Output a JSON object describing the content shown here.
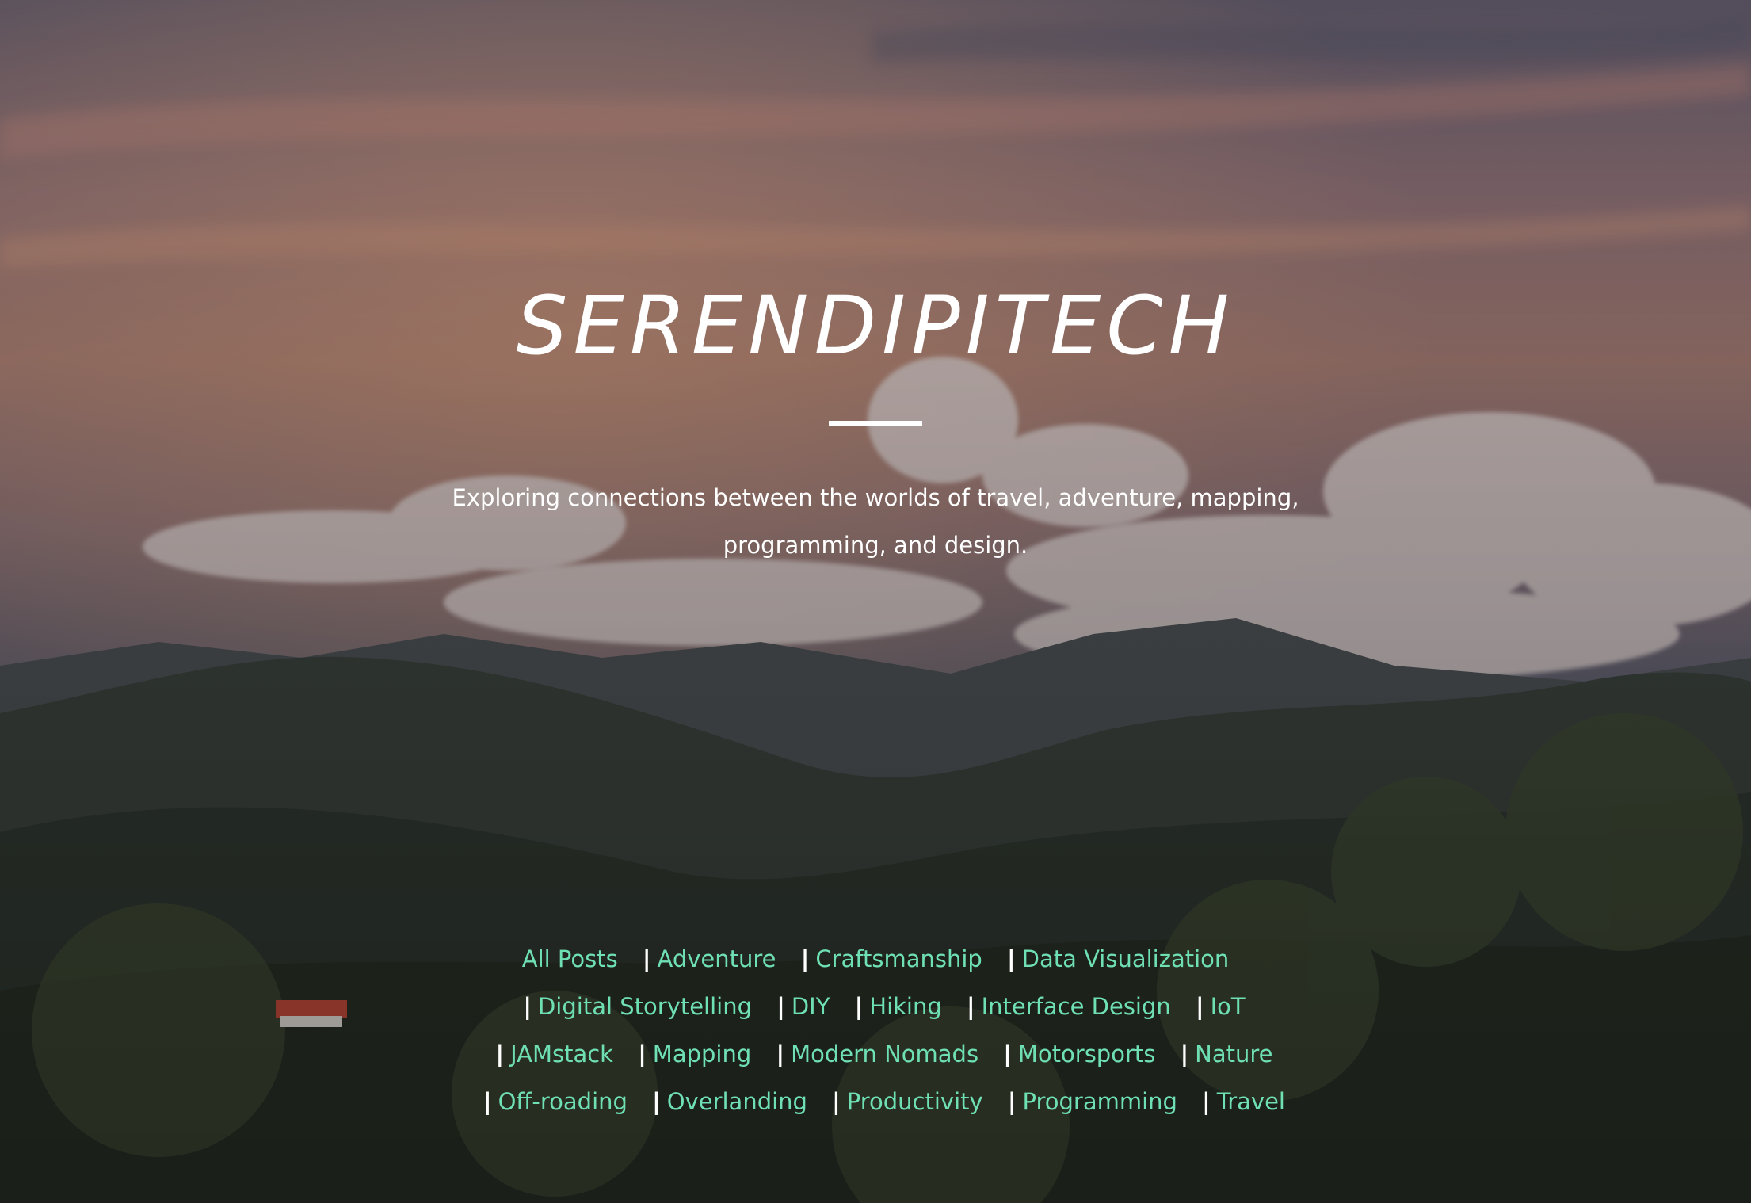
{
  "site": {
    "title": "SERENDIPITECH",
    "tagline": "Exploring connections between the worlds of travel, adventure, mapping, programming, and design."
  },
  "categories": {
    "separator": "|",
    "items": [
      "All Posts",
      "Adventure",
      "Craftsmanship",
      "Data Visualization",
      "Digital Storytelling",
      "DIY",
      "Hiking",
      "Interface Design",
      "IoT",
      "JAMstack",
      "Mapping",
      "Modern Nomads",
      "Motorsports",
      "Nature",
      "Off-roading",
      "Overlanding",
      "Productivity",
      "Programming",
      "Travel"
    ]
  },
  "colors": {
    "link": "#6fe0b4",
    "text": "#ffffff"
  },
  "icons": {
    "background": "mountain-landscape-photo"
  }
}
